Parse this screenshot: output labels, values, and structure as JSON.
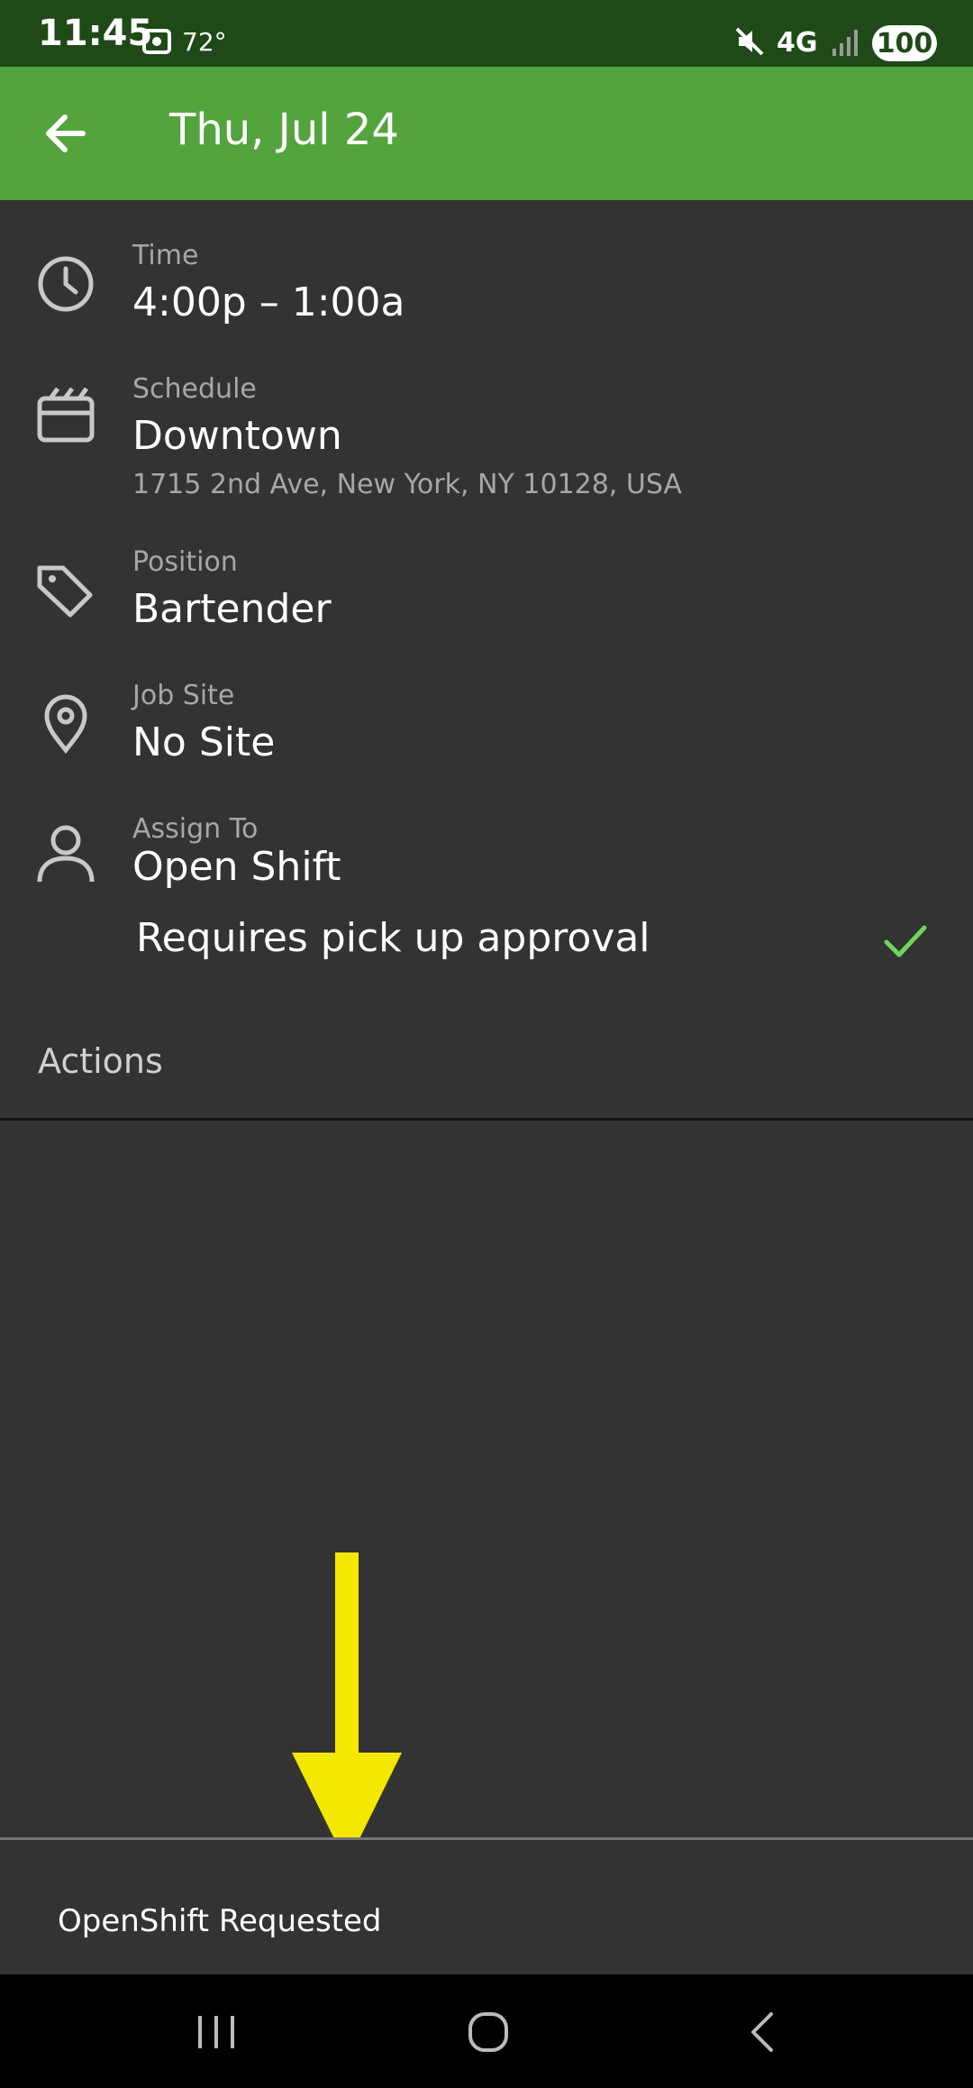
{
  "status_bar": {
    "time": "11:45",
    "temperature": "72°",
    "network": "4G",
    "battery": "100"
  },
  "app_bar": {
    "title": "Thu, Jul 24"
  },
  "details": {
    "time": {
      "label": "Time",
      "value": "4:00p – 1:00a"
    },
    "schedule": {
      "label": "Schedule",
      "value": "Downtown",
      "address": "1715 2nd Ave, New York, NY 10128, USA"
    },
    "position": {
      "label": "Position",
      "value": "Bartender"
    },
    "job_site": {
      "label": "Job Site",
      "value": "No Site"
    },
    "assign_to": {
      "label": "Assign To",
      "value": "Open Shift"
    },
    "approval": {
      "label": "Requires pick up approval",
      "checked": true
    }
  },
  "actions": {
    "label": "Actions"
  },
  "snackbar": {
    "message": "OpenShift Requested"
  },
  "colors": {
    "status_bar": "#1f4a18",
    "app_bar": "#54a43d",
    "background": "#333333",
    "check": "#6fd45a",
    "arrow": "#f5e800"
  },
  "icons": [
    "back-arrow-icon",
    "clock-icon",
    "calendar-icon",
    "tag-icon",
    "location-pin-icon",
    "person-icon",
    "check-icon",
    "recents-icon",
    "home-icon",
    "back-icon"
  ]
}
